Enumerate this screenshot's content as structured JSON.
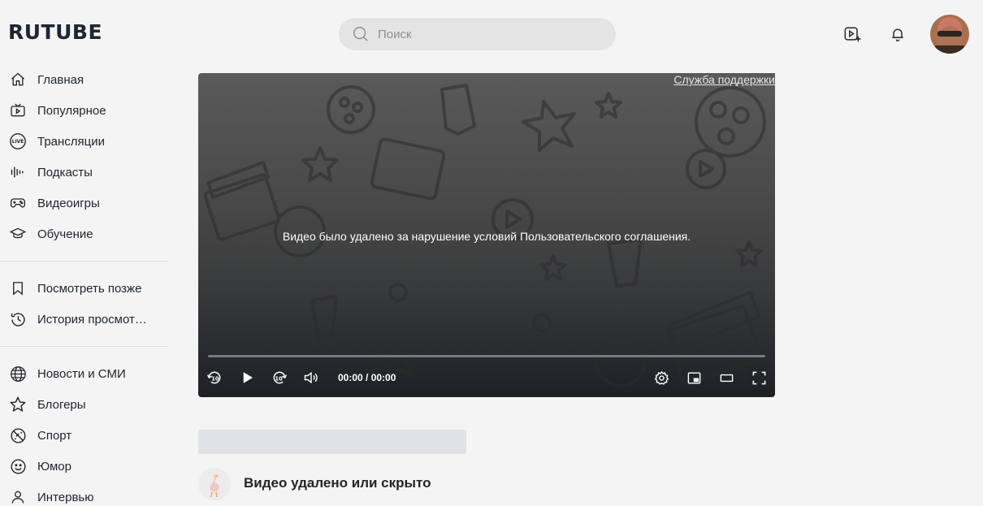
{
  "header": {
    "logo": "RUTUBE",
    "search_placeholder": "Поиск",
    "icons": [
      "upload-video-icon",
      "bell-icon",
      "user-avatar"
    ]
  },
  "sidebar": {
    "groups": [
      [
        {
          "label": "Главная",
          "icon": "home-icon"
        },
        {
          "label": "Популярное",
          "icon": "tv-icon"
        },
        {
          "label": "Трансляции",
          "icon": "live-icon"
        },
        {
          "label": "Подкасты",
          "icon": "podcast-icon"
        },
        {
          "label": "Видеоигры",
          "icon": "gamepad-icon"
        },
        {
          "label": "Обучение",
          "icon": "graduation-cap-icon"
        }
      ],
      [
        {
          "label": "Посмотреть позже",
          "icon": "bookmark-icon"
        },
        {
          "label": "История просмот…",
          "icon": "history-icon"
        }
      ],
      [
        {
          "label": "Новости и СМИ",
          "icon": "globe-icon"
        },
        {
          "label": "Блогеры",
          "icon": "star-icon"
        },
        {
          "label": "Спорт",
          "icon": "ball-icon"
        },
        {
          "label": "Юмор",
          "icon": "smile-icon"
        },
        {
          "label": "Интервью",
          "icon": "person-icon"
        }
      ]
    ]
  },
  "player": {
    "support_link": "Служба поддержки",
    "message": "Видео было удалено за нарушение условий Пользовательского соглашения.",
    "time": "00:00 / 00:00",
    "progress": 0
  },
  "video": {
    "title": "Видео удалено или скрыто"
  },
  "colors": {
    "background": "#f4f4f4",
    "text": "#22252a",
    "search_bg": "#e4e4e4",
    "skeleton": "#e0e2e6"
  }
}
